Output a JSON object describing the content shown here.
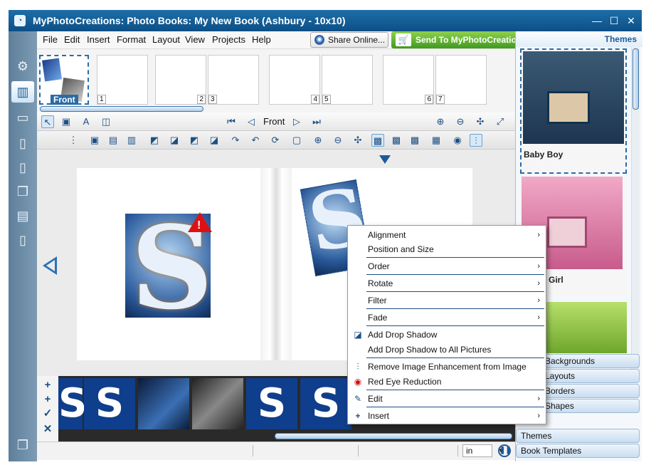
{
  "window": {
    "title": "MyPhotoCreations: Photo Books: My New Book (Ashbury - 10x10)",
    "min_glyph": "—",
    "max_glyph": "☐",
    "close_glyph": "✕"
  },
  "menubar": {
    "items": [
      "File",
      "Edit",
      "Insert",
      "Format",
      "Layout",
      "View",
      "Projects",
      "Help"
    ],
    "share_label": "Share Online...",
    "send_label": "Send To MyPhotoCreations"
  },
  "page_strip": {
    "front_label": "Front",
    "page_numbers": [
      "1",
      "2",
      "3",
      "4",
      "5",
      "6",
      "7"
    ]
  },
  "nav": {
    "current_label": "Front"
  },
  "status": {
    "unit_value": "in"
  },
  "right_panel": {
    "header": "Themes",
    "themes": [
      {
        "name": "Baby Boy"
      },
      {
        "name": "Girl"
      }
    ],
    "tabs": [
      "Backgrounds",
      "Layouts",
      "Borders",
      "Shapes",
      "Themes",
      "Book Templates"
    ]
  },
  "context_menu": {
    "items": [
      {
        "label": "Alignment",
        "submenu": true
      },
      {
        "label": "Position and Size",
        "submenu": false
      },
      {
        "label": "Order",
        "submenu": true
      },
      {
        "label": "Rotate",
        "submenu": true
      },
      {
        "label": "Filter",
        "submenu": true
      },
      {
        "label": "Fade",
        "submenu": true
      },
      {
        "label": "Add Drop Shadow",
        "submenu": false
      },
      {
        "label": "Add Drop Shadow to All Pictures",
        "submenu": false
      },
      {
        "label": "Remove Image Enhancement from Image",
        "submenu": false
      },
      {
        "label": "Red Eye Reduction",
        "submenu": false
      },
      {
        "label": "Edit",
        "submenu": true
      },
      {
        "label": "Insert",
        "submenu": true
      }
    ],
    "submenu_arrow": "›"
  },
  "colors": {
    "accent": "#1c5a97",
    "send_green": "#3f9a1f",
    "warning_red": "#dd1111"
  }
}
